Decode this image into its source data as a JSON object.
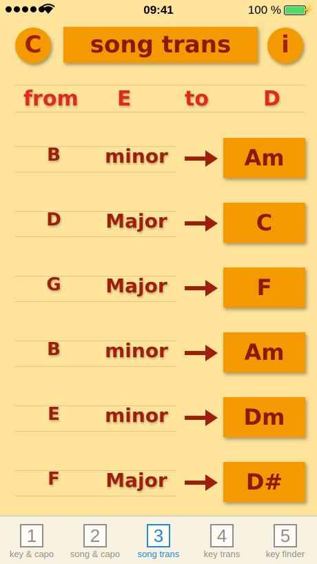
{
  "status_bar": {
    "time": "09:41",
    "battery": "100 %"
  },
  "header": {
    "left_button": "C",
    "title": "song trans",
    "right_button": "i"
  },
  "transpose": {
    "from_label": "from",
    "from_key": "E",
    "to_label": "to",
    "to_key": "D"
  },
  "rows": [
    {
      "note": "B",
      "quality": "minor",
      "result": "Am"
    },
    {
      "note": "D",
      "quality": "Major",
      "result": "C"
    },
    {
      "note": "G",
      "quality": "Major",
      "result": "F"
    },
    {
      "note": "B",
      "quality": "minor",
      "result": "Am"
    },
    {
      "note": "E",
      "quality": "minor",
      "result": "Dm"
    },
    {
      "note": "F",
      "quality": "Major",
      "result": "D#"
    }
  ],
  "tabs": [
    {
      "number": "1",
      "label": "key & capo"
    },
    {
      "number": "2",
      "label": "song & capo"
    },
    {
      "number": "3",
      "label": "song trans",
      "active": true
    },
    {
      "number": "4",
      "label": "key trans"
    },
    {
      "number": "5",
      "label": "key finder"
    }
  ],
  "colors": {
    "background": "#fde49a",
    "accent": "#f39a00",
    "text_dark_red": "#8b1a0a",
    "text_red": "#e02a1c",
    "tab_active": "#1e88e5"
  }
}
